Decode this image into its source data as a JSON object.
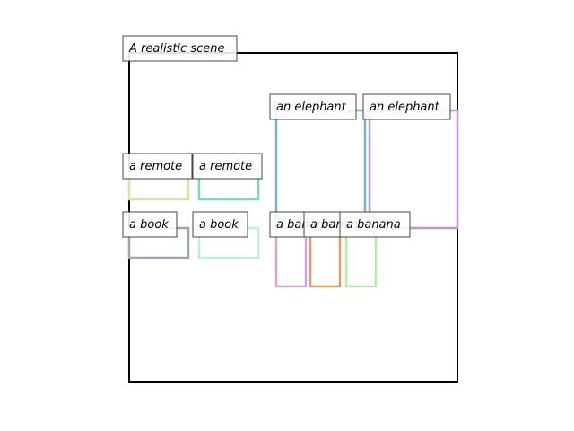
{
  "scene": {
    "caption": "A realistic scene",
    "frame_color": "#000000"
  },
  "objects": [
    {
      "label": "an elephant",
      "color": "#7bafd4"
    },
    {
      "label": "an elephant",
      "color": "#c095cc"
    },
    {
      "label": "a remote",
      "color": "#d6e4a6"
    },
    {
      "label": "a remote",
      "color": "#7fd3c4"
    },
    {
      "label": "a book",
      "color": "#9aa6b4"
    },
    {
      "label": "a book",
      "color": "#bff0d6"
    },
    {
      "label": "a banana",
      "color": "#dba2d8"
    },
    {
      "label": "a banana",
      "color": "#e09a66"
    },
    {
      "label": "a banana",
      "color": "#b4ecb0"
    }
  ]
}
